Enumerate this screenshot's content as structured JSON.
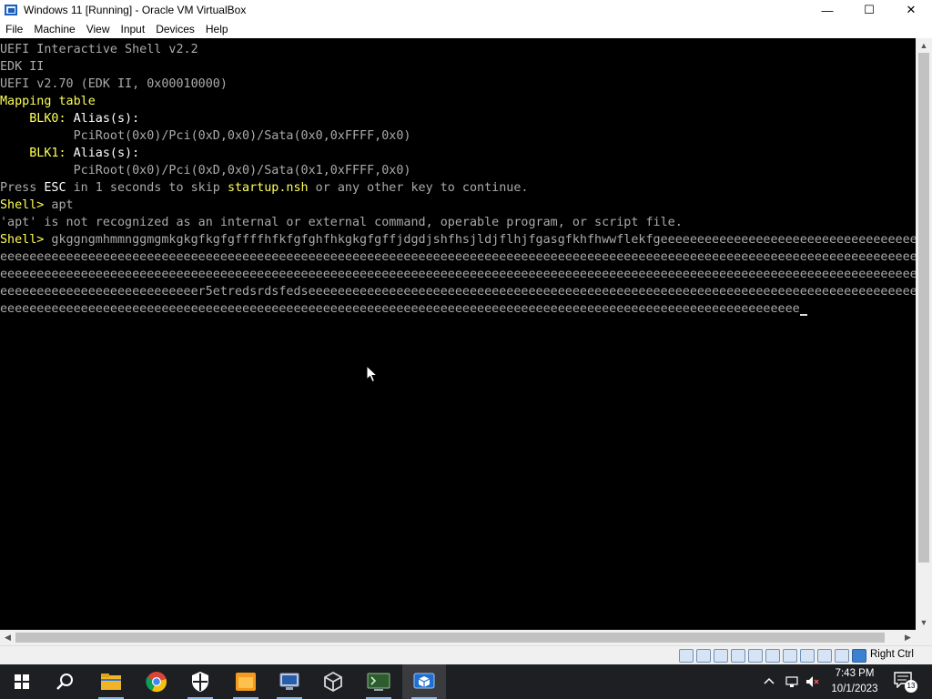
{
  "window": {
    "title": "Windows 11 [Running] - Oracle VM VirtualBox",
    "minimize_glyph": "—",
    "maximize_glyph": "☐",
    "close_glyph": "✕"
  },
  "menu": {
    "items": [
      "File",
      "Machine",
      "View",
      "Input",
      "Devices",
      "Help"
    ]
  },
  "console": {
    "lines": [
      {
        "text": "UEFI Interactive Shell v2.2"
      },
      {
        "text": "EDK II"
      },
      {
        "text": "UEFI v2.70 (EDK II, 0x00010000)"
      },
      {
        "text": "Mapping table"
      },
      {
        "blk_label": "BLK0:",
        "alias": " Alias(s):"
      },
      {
        "text": "          PciRoot(0x0)/Pci(0xD,0x0)/Sata(0x0,0xFFFF,0x0)"
      },
      {
        "blk_label": "BLK1:",
        "alias": " Alias(s):"
      },
      {
        "text": "          PciRoot(0x0)/Pci(0xD,0x0)/Sata(0x1,0xFFFF,0x0)"
      },
      {
        "press": "Press ",
        "esc": "ESC",
        "mid": " in 1 seconds to skip ",
        "nsh": "startup.nsh",
        "tail": " or any other key to continue."
      },
      {
        "prompt": "Shell>",
        "cmd": " apt"
      },
      {
        "text": "'apt' is not recognized as an internal or external command, operable program, or script file."
      },
      {
        "prompt": "Shell>",
        "cmd": " gkggngmhmmnggmgmkgkgfkgfgffffhfkfgfghfhkgkgfgffjdgdjshfhsjldjflhjfgasgfkhfhwwflekfgeeeeeeeeeeeeeeeeeeeeeeeeeeeeeeeeeeeeeee"
      },
      {
        "text": "eeeeeeeeeeeeeeeeeeeeeeeeeeeeeeeeeeeeeeeeeeeeeeeeeeeeeeeeeeeeeeeeeeeeeeeeeeeeeeeeeeeeeeeeeeeeeeeeeeeeeeeeeeeeeeeeeeeeeeeeeeeeeeeeeeeee"
      },
      {
        "text": "eeeeeeeeeeeeeeeeeeeeeeeeeeeeeeeeeeeeeeeeeeeeeeeeeeeeeeeeeeeeeeeeeeeeeeeeeeeeeeeeeeeeeeeeeeeeeeeeeeeeeeeeeeeeeeeeeeeeeeeeeeeeeeeeeeeee"
      },
      {
        "text": "eeeeeeeeeeeeeeeeeeeeeeeeeeer5etredsrdsfedseeeeeeeeeeeeeeeeeeeeeeeeeeeeeeeeeeeeeeeeeeeeeeeeeeeeeeeeeeeeeeeeeeeeeeeeeeeeeeeeeeeeeeeeeeeee"
      },
      {
        "text": "eeeeeeeeeeeeeeeeeeeeeeeeeeeeeeeeeeeeeeeeeeeeeeeeeeeeeeeeeeeeeeeeeeeeeeeeeeeeeeeeeeeeeeeeeeeeeeeeeeeeeeeeeeeee"
      }
    ],
    "text_color": "#aaaaaa",
    "highlight_color": "#ffff55"
  },
  "statusbar": {
    "host_key": "Right Ctrl"
  },
  "taskbar": {
    "apps": [
      "start-icon",
      "search-icon",
      "file-explorer-icon",
      "chrome-icon",
      "security-icon",
      "folder-icon",
      "remote-desktop-icon",
      "virtualbox-cube-icon",
      "terminal-icon",
      "virtualbox-manager-icon"
    ],
    "time": "7:43 PM",
    "date": "10/1/2023",
    "notification_count": "13"
  }
}
